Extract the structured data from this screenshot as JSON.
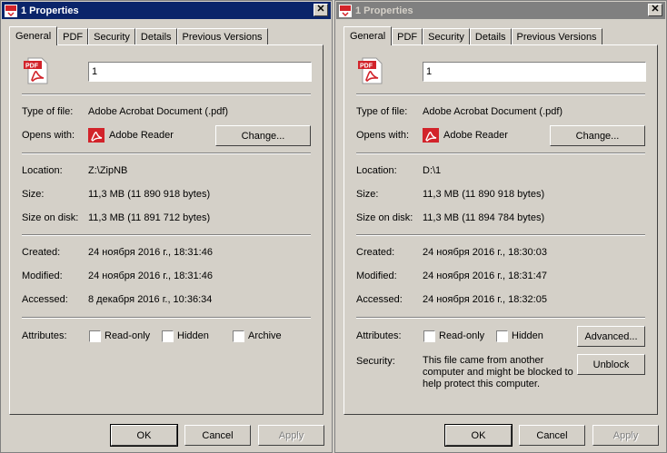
{
  "dialogs": [
    {
      "title": "1 Properties",
      "tabs": [
        "General",
        "PDF",
        "Security",
        "Details",
        "Previous Versions"
      ],
      "name_value": "1",
      "type_label": "Type of file:",
      "type_value": "Adobe Acrobat Document (.pdf)",
      "opens_label": "Opens with:",
      "opens_value": "Adobe Reader",
      "change_label": "Change...",
      "location_label": "Location:",
      "location_value": "Z:\\ZipNB",
      "size_label": "Size:",
      "size_value": "11,3 MB (11 890 918 bytes)",
      "disk_label": "Size on disk:",
      "disk_value": "11,3 MB (11 891 712 bytes)",
      "created_label": "Created:",
      "created_value": "24 ноября 2016 г., 18:31:46",
      "modified_label": "Modified:",
      "modified_value": "24 ноября 2016 г., 18:31:46",
      "accessed_label": "Accessed:",
      "accessed_value": "8 декабря 2016 г., 10:36:34",
      "attributes_label": "Attributes:",
      "readonly_label": "Read-only",
      "hidden_label": "Hidden",
      "archive_label": "Archive",
      "ok_label": "OK",
      "cancel_label": "Cancel",
      "apply_label": "Apply"
    },
    {
      "title": "1 Properties",
      "tabs": [
        "General",
        "PDF",
        "Security",
        "Details",
        "Previous Versions"
      ],
      "name_value": "1",
      "type_label": "Type of file:",
      "type_value": "Adobe Acrobat Document (.pdf)",
      "opens_label": "Opens with:",
      "opens_value": "Adobe Reader",
      "change_label": "Change...",
      "location_label": "Location:",
      "location_value": "D:\\1",
      "size_label": "Size:",
      "size_value": "11,3 MB (11 890 918 bytes)",
      "disk_label": "Size on disk:",
      "disk_value": "11,3 MB (11 894 784 bytes)",
      "created_label": "Created:",
      "created_value": "24 ноября 2016 г., 18:30:03",
      "modified_label": "Modified:",
      "modified_value": "24 ноября 2016 г., 18:31:47",
      "accessed_label": "Accessed:",
      "accessed_value": "24 ноября 2016 г., 18:32:05",
      "attributes_label": "Attributes:",
      "readonly_label": "Read-only",
      "hidden_label": "Hidden",
      "advanced_label": "Advanced...",
      "security_label": "Security:",
      "security_text": "This file came from another computer and might be blocked to help protect this computer.",
      "unblock_label": "Unblock",
      "ok_label": "OK",
      "cancel_label": "Cancel",
      "apply_label": "Apply"
    }
  ],
  "colors": {
    "active_title": "#0a246a",
    "inactive_title": "#808080",
    "face": "#d4d0c8",
    "pdf_red": "#d2232a"
  }
}
